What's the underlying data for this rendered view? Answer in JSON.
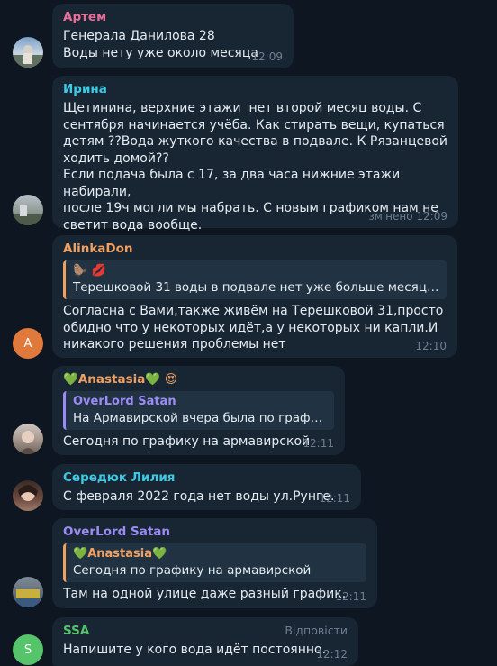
{
  "colors": {
    "background": "#0e1621",
    "bubble": "#182533",
    "name_artem": "#e86f99",
    "name_irina": "#3ec9e4",
    "name_alinka": "#f0a060",
    "name_anastasia": "#f0a060",
    "name_serediuk": "#3ec9e4",
    "name_overlord": "#9b8cf5",
    "name_ssa": "#55c46a"
  },
  "messages": [
    {
      "sender": "Артем",
      "text": "Генерала Данилова 28\nВоды нету уже около месяца",
      "time": "12:09",
      "avatar_icon": "photo-avatar"
    },
    {
      "sender": "Ирина",
      "text": "Щетинина, верхние этажи  нет второй месяц воды. С\nсентября начинается учёба. Как стирать вещи, купаться\nдетям ??Вода жуткого качества в подвале. К Рязанцевой\nходить домой??\nЕсли подача была с 17, за два часа нижние этажи набирали,\nпосле 19ч могли мы набрать. С новым графиком нам не\nсветит вода вообще.",
      "time": "змінено 12:09",
      "avatar_icon": "photo-avatar"
    },
    {
      "sender": "AlinkaDon",
      "reply_name": "🦫 💋",
      "reply_text": "Терешковой 31 воды в подвале нет уже больше месяца. ...",
      "text": "Согласна с Вами,также живём на Терешковой 31,просто\nобидно что у некоторых идёт,а у некоторых ни капли.И\nникакого решения проблемы нет",
      "time": "12:10",
      "avatar_letter": "A"
    },
    {
      "sender": "Anastasia",
      "sender_suffix": "😍",
      "reply_name": "OverLord Satan",
      "reply_text": "На Армавирской вчера была по графи...",
      "text": "Сегодня по графику на армавирской",
      "time": "12:11",
      "avatar_icon": "photo-avatar"
    },
    {
      "sender": "Середюк Лилия",
      "text": "С февраля 2022 года нет воды ул.Рунге.",
      "time": "12:11",
      "avatar_icon": "photo-avatar"
    },
    {
      "sender": "OverLord Satan",
      "reply_name": "Anastasia",
      "reply_text": "Сегодня по графику на армавирской",
      "text": "Там на одной улице даже разный график.",
      "time": "12:11",
      "avatar_icon": "photo-avatar"
    },
    {
      "sender": "SSA",
      "reply_action": "Відповісти",
      "text": "Напишите у кого вода идёт постоянно.",
      "time": "12:12",
      "avatar_letter": "S"
    }
  ]
}
